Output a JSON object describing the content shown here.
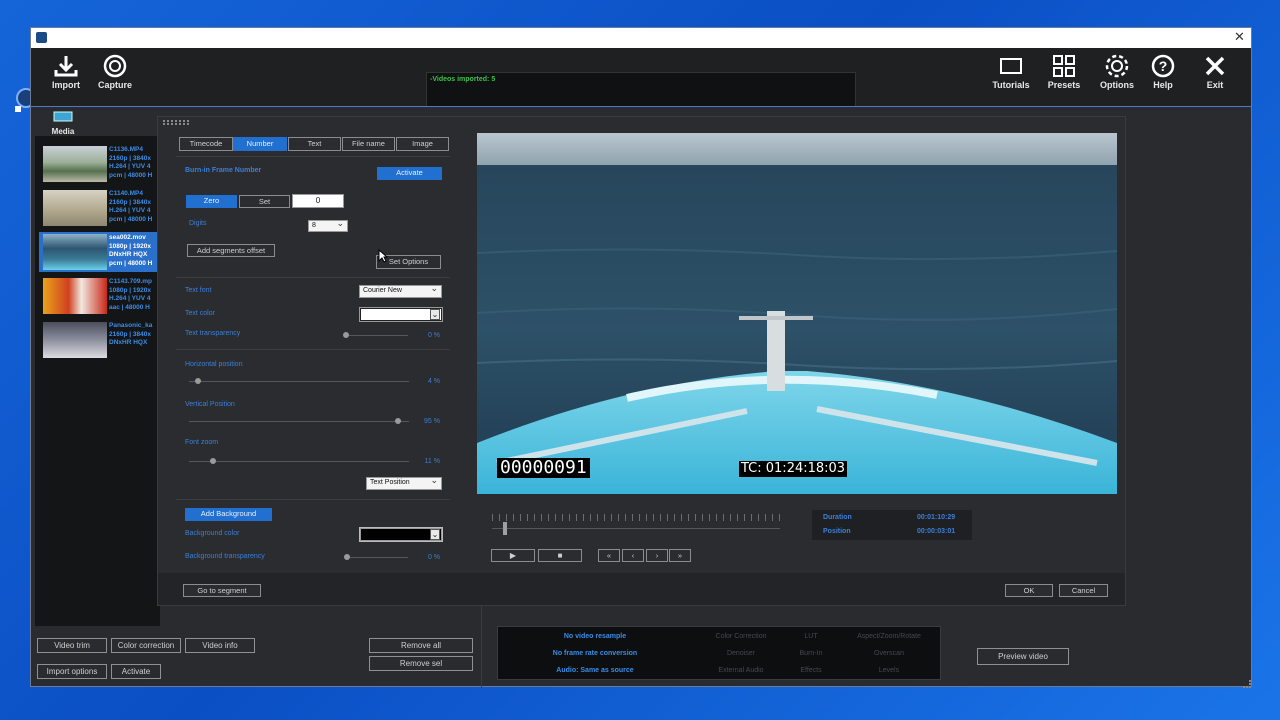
{
  "toolbar": {
    "import": "Import",
    "capture": "Capture",
    "tutorials": "Tutorials",
    "presets": "Presets",
    "options": "Options",
    "help": "Help",
    "exit": "Exit"
  },
  "log": {
    "message": "-Videos imported: 5"
  },
  "media_label": "Media",
  "media_items": [
    {
      "name": "C1136.MP4",
      "line1": "2160p | 3840x",
      "line2": "H.264 | YUV 4",
      "line3": "pcm | 48000 H"
    },
    {
      "name": "C1140.MP4",
      "line1": "2160p | 3840x",
      "line2": "H.264 | YUV 4",
      "line3": "pcm | 48000 H"
    },
    {
      "name": "sea002.mov",
      "line1": "1080p | 1920x",
      "line2": "DNxHR HQX",
      "line3": "pcm | 48000 H"
    },
    {
      "name": "C1143.709.mp",
      "line1": "1080p | 1920x",
      "line2": "H.264 | YUV 4",
      "line3": "aac | 48000 H"
    },
    {
      "name": "Panasonic_ka",
      "line1": "2160p | 3840x",
      "line2": "DNxHR HQX",
      "line3": ""
    }
  ],
  "dialog": {
    "tabs": [
      "Timecode",
      "Number",
      "Text",
      "File name",
      "Image"
    ],
    "burn_in_label": "Burn-in Frame Number",
    "activate": "Activate",
    "zero": "Zero",
    "set": "Set",
    "number_value": "0",
    "digits_label": "Digits",
    "digits_value": "8",
    "add_segments_offset": "Add segments offset",
    "set_options": "Set Options",
    "text_font_label": "Text font",
    "text_font_value": "Courier New",
    "text_color_label": "Text color",
    "text_transparency_label": "Text transparency",
    "text_transparency_value": "0 %",
    "horizontal_label": "Horizontal position",
    "horizontal_value": "4 %",
    "vertical_label": "Vertical Position",
    "vertical_value": "95 %",
    "font_zoom_label": "Font zoom",
    "font_zoom_value": "11 %",
    "text_position": "Text Position",
    "add_background": "Add Background",
    "bg_color_label": "Background color",
    "bg_transparency_label": "Background transparency",
    "bg_transparency_value": "0 %",
    "go_to_segment": "Go to segment",
    "ok": "OK",
    "cancel": "Cancel",
    "overlay_number": "00000091",
    "overlay_tc": "TC: 01:24:18:03",
    "duration_label": "Duration",
    "duration_value": "00:01:10:29",
    "position_label": "Position",
    "position_value": "00:00:03:01",
    "text_transparency_level": 0,
    "horizontal_level": 4,
    "vertical_level": 95,
    "font_zoom_level": 11
  },
  "bottom": {
    "video_trim": "Video trim",
    "color_correction": "Color correction",
    "video_info": "Video info",
    "remove_all": "Remove all",
    "remove_sel": "Remove sel",
    "import_options": "Import options",
    "activate": "Activate",
    "no_video_resample": "No video resample",
    "no_frame_rate": "No frame rate conversion",
    "audio_same": "Audio: Same as source",
    "grey_items": [
      "Color Correction",
      "LUT",
      "Aspect/Zoom/Rotate",
      "Denoiser",
      "Burn-In",
      "Overscan",
      "External Audio",
      "Effects",
      "Levels"
    ],
    "preview_video": "Preview video"
  },
  "colors": {
    "accent": "#2170d0",
    "label_blue": "#3b7fd8",
    "log_green": "#3ec24a",
    "background": "#2a2b2e"
  }
}
